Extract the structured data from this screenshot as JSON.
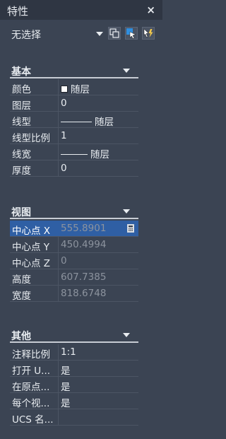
{
  "title": "特性",
  "close_glyph": "×",
  "selection": "无选择",
  "sections": {
    "basic": {
      "label": "基本",
      "rows": [
        {
          "key": "颜色",
          "value": "随层"
        },
        {
          "key": "图层",
          "value": "0"
        },
        {
          "key": "线型",
          "value": "随层"
        },
        {
          "key": "线型比例",
          "value": "1"
        },
        {
          "key": "线宽",
          "value": "随层"
        },
        {
          "key": "厚度",
          "value": "0"
        }
      ]
    },
    "view": {
      "label": "视图",
      "rows": [
        {
          "key": "中心点 X",
          "value": "555.8901"
        },
        {
          "key": "中心点 Y",
          "value": "450.4994"
        },
        {
          "key": "中心点 Z",
          "value": "0"
        },
        {
          "key": "高度",
          "value": "607.7385"
        },
        {
          "key": "宽度",
          "value": "818.6748"
        }
      ]
    },
    "other": {
      "label": "其他",
      "rows": [
        {
          "key": "注释比例",
          "value": "1:1"
        },
        {
          "key": "打开 U...",
          "value": "是"
        },
        {
          "key": "在原点...",
          "value": "是"
        },
        {
          "key": "每个视...",
          "value": "是"
        },
        {
          "key": "UCS 名...",
          "value": ""
        }
      ]
    }
  },
  "colors": {
    "accent": "#2f5fa4",
    "panel_bg": "#3b4453",
    "titlebar_bg": "#2f3643"
  }
}
